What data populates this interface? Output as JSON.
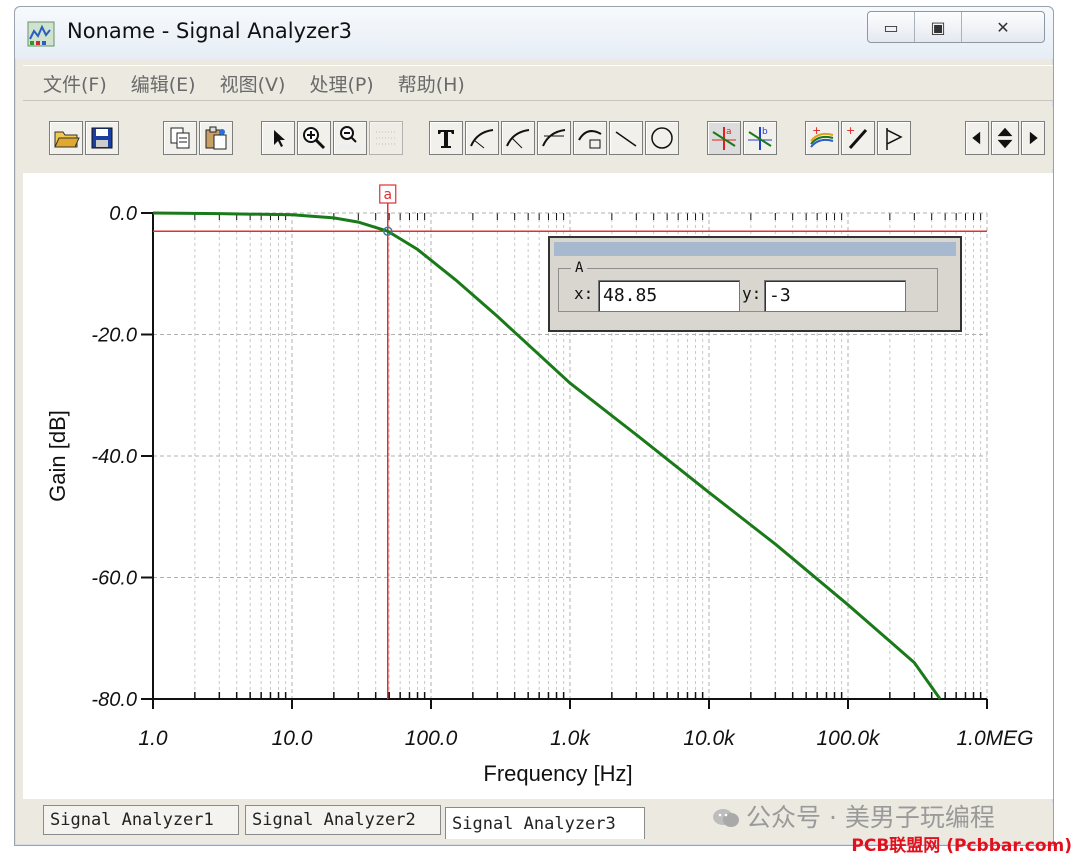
{
  "window": {
    "title": "Noname - Signal Analyzer3",
    "controls": [
      "minimize-icon",
      "maximize-icon",
      "close-icon"
    ]
  },
  "menu": [
    {
      "label": "文件(F)"
    },
    {
      "label": "编辑(E)"
    },
    {
      "label": "视图(V)"
    },
    {
      "label": "处理(P)"
    },
    {
      "label": "帮助(H)"
    }
  ],
  "toolbar": [
    "open-folder-icon",
    "save-icon",
    "copy-icon",
    "paste-icon",
    "pointer-icon",
    "zoom-in-icon",
    "zoom-100-icon",
    "grid-icon",
    "text-icon",
    "draw-1-icon",
    "draw-2-icon",
    "draw-3-icon",
    "line-icon",
    "circle-icon",
    "cursor-a-icon",
    "cursor-b-icon",
    "add-trace-icon",
    "pick-icon",
    "flag-icon",
    "left-icon",
    "updown-icon",
    "right-icon"
  ],
  "chart_data": {
    "type": "line",
    "xlabel": "Frequency [Hz]",
    "ylabel": "Gain [dB]",
    "x_scale": "log",
    "xlim": [
      1,
      1000000
    ],
    "ylim": [
      -80,
      0
    ],
    "x_tick_labels": [
      "1.0",
      "10.0",
      "100.0",
      "1.0k",
      "10.0k",
      "100.0k",
      "1.0MEG"
    ],
    "y_tick_labels": [
      "0.0",
      "-20.0",
      "-40.0",
      "-60.0",
      "-80.0"
    ],
    "y_ticks": [
      0,
      -20,
      -40,
      -60,
      -80
    ],
    "grid": true,
    "series": [
      {
        "color": "#1a7a1a",
        "x": [
          1,
          3,
          10,
          20,
          30,
          48.85,
          80,
          150,
          300,
          1000,
          3000,
          10000,
          30000,
          100000,
          300000,
          460000
        ],
        "y": [
          0,
          -0.1,
          -0.3,
          -0.8,
          -1.5,
          -3,
          -6,
          -11,
          -17,
          -28,
          -36.5,
          -46,
          -54.5,
          -64.5,
          -74,
          -80
        ]
      }
    ],
    "cursor": {
      "label": "a",
      "x": 48.85,
      "y": -3,
      "color": "#e03030"
    }
  },
  "cursor_panel": {
    "group": "A",
    "x_label": "x:",
    "x_value": "48.85",
    "y_label": "y:",
    "y_value": "-3"
  },
  "tabs": [
    {
      "label": "Signal Analyzer1"
    },
    {
      "label": "Signal Analyzer2"
    },
    {
      "label": "Signal Analyzer3"
    }
  ],
  "watermark": "公众号 · 美男子玩编程",
  "footer_watermark": "PCB联盟网 (Pcbbar.com)"
}
